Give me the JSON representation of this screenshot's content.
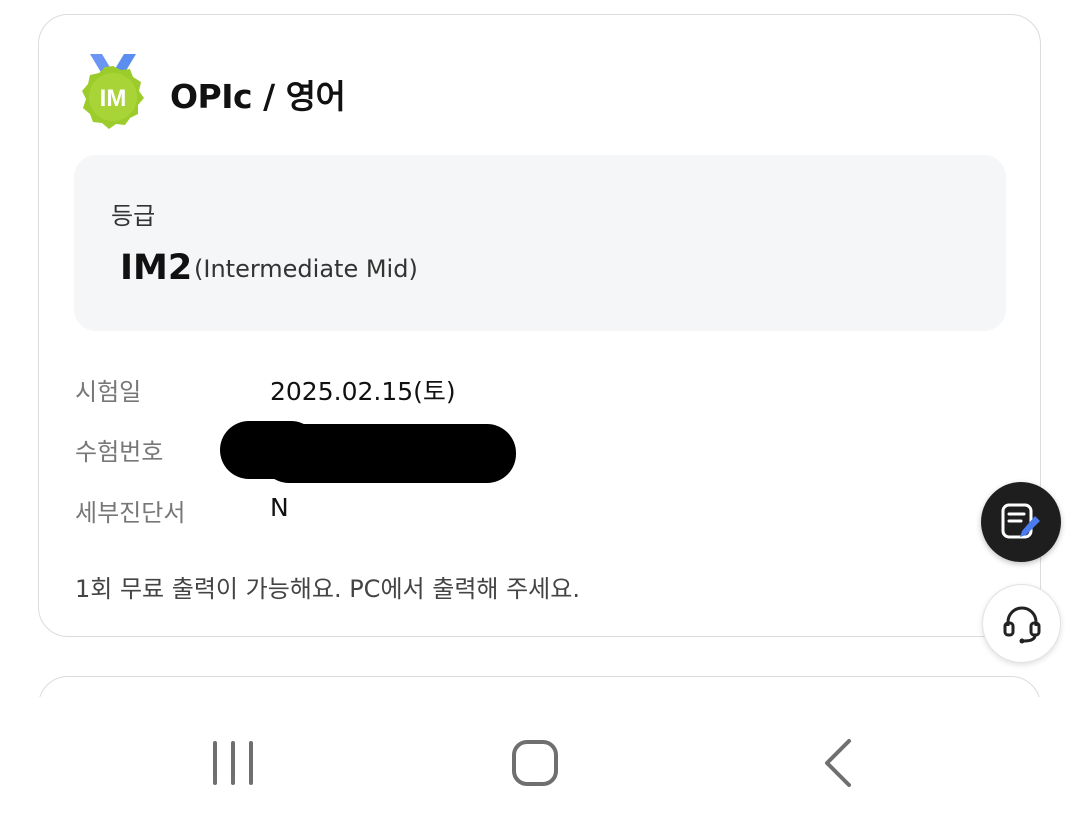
{
  "card": {
    "badge_text": "IM",
    "title": "OPIc / 영어",
    "grade": {
      "label": "등급",
      "value": "IM2",
      "description": "(Intermediate Mid)"
    },
    "details": [
      {
        "label": "시험일",
        "value": "2025.02.15(토)"
      },
      {
        "label": "수험번호",
        "value": ""
      },
      {
        "label": "세부진단서",
        "value": "N"
      }
    ],
    "notice": "1회 무료 출력이 가능해요. PC에서 출력해 주세요."
  },
  "fabs": {
    "memo_icon": "memo-edit-icon",
    "support_icon": "headset-icon"
  },
  "nav": [
    "recent-apps-icon",
    "home-icon",
    "back-icon"
  ],
  "colors": {
    "badge_green": "#9ccc2c",
    "ribbon_blue": "#5b8ef0",
    "fab_dark": "#1e1e1e",
    "pen_blue": "#4a7cf0"
  }
}
